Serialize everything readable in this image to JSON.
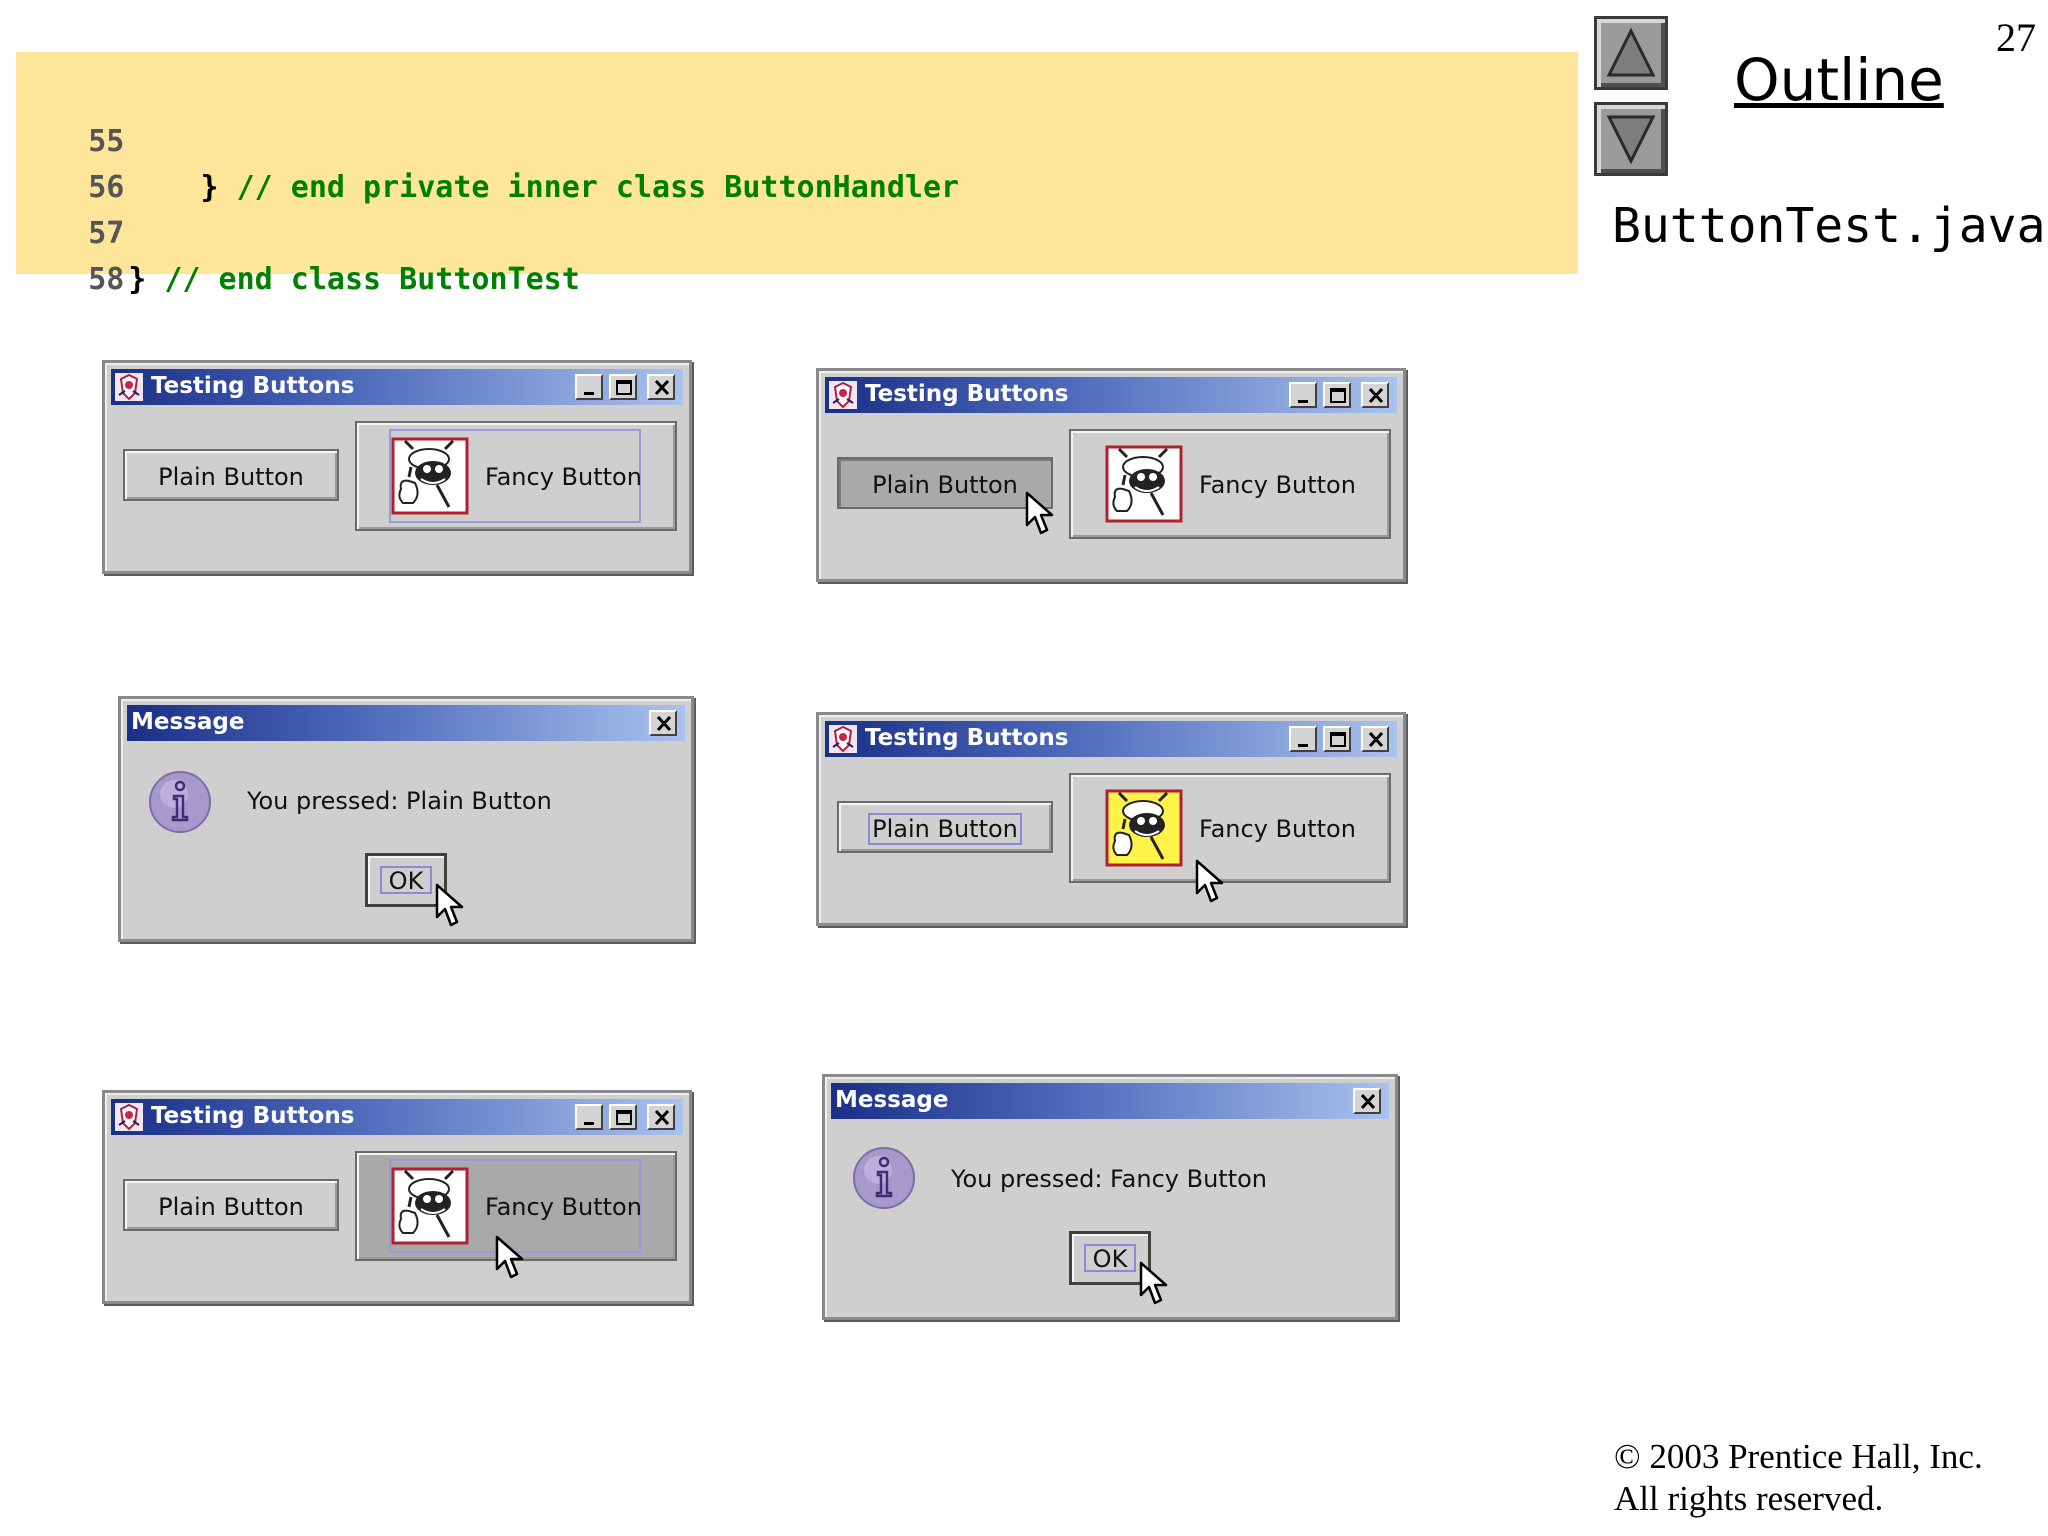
{
  "slide": {
    "page_number": "27",
    "outline_label": "Outline",
    "file_name": "ButtonTest.java",
    "copyright_line1": "© 2003 Prentice Hall, Inc.",
    "copyright_line2": "All rights reserved."
  },
  "code": {
    "lines": [
      {
        "num": "55",
        "brace": "",
        "text": ""
      },
      {
        "num": "56",
        "brace": "    } ",
        "text": "// end private inner class ButtonHandler"
      },
      {
        "num": "57",
        "brace": "",
        "text": ""
      },
      {
        "num": "58",
        "brace": "} ",
        "text": "// end class ButtonTest"
      }
    ]
  },
  "windows": {
    "testing_title": "Testing Buttons",
    "message_title": "Message",
    "plain_label": "Plain Button",
    "fancy_label": "Fancy Button",
    "ok_label": "OK",
    "msg_plain": "You pressed: Plain Button",
    "msg_fancy": "You pressed: Fancy Button"
  },
  "icons": [
    "nav-up-arrow-icon",
    "nav-down-arrow-icon",
    "java-duke-icon",
    "minimize-icon",
    "maximize-icon",
    "close-icon",
    "bug-thumbs-up-icon",
    "info-icon",
    "mouse-pointer-icon"
  ],
  "colors": {
    "code_background": "#fde69a",
    "code_text": "#008000",
    "titlebar_start": "#1a2f86",
    "titlebar_end": "#a9c2ee",
    "window_bg": "#cfcfcf"
  }
}
